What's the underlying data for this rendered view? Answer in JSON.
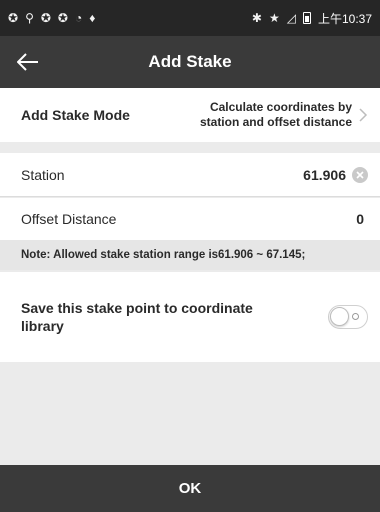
{
  "status_bar": {
    "time": "上午10:37",
    "left_icons": [
      "sync-icon",
      "signal-icon",
      "sync-icon",
      "sync-icon",
      "sync-icon",
      "location-pin-icon"
    ],
    "right_icons": [
      "bluetooth-icon",
      "star-icon",
      "no-signal-icon",
      "battery-icon"
    ]
  },
  "header": {
    "title": "Add Stake",
    "back_icon": "arrow-left-icon"
  },
  "mode": {
    "label": "Add Stake Mode",
    "value_line1": "Calculate coordinates by",
    "value_line2": "station and offset distance"
  },
  "station": {
    "label": "Station",
    "value": "61.906"
  },
  "offset": {
    "label": "Offset Distance",
    "value": "0"
  },
  "note": "Note: Allowed stake station range is61.906 ~ 67.145;",
  "save": {
    "label_line1": "Save this stake point to coordinate",
    "label_line2": "library",
    "toggle_on": false
  },
  "ok_label": "OK",
  "colors": {
    "header_bg": "#3a3a3a",
    "status_bg": "#262626",
    "page_bg": "#ebebeb"
  }
}
